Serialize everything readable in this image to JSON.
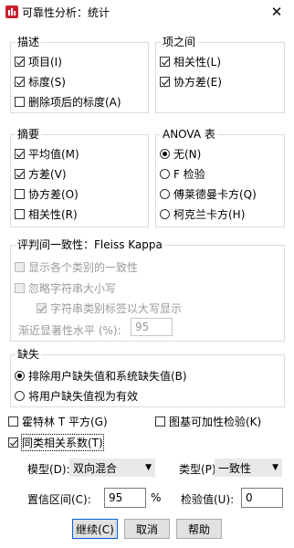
{
  "window": {
    "title": "可靠性分析：统计",
    "close_label": "✕"
  },
  "descriptives": {
    "legend": "描述",
    "items": [
      {
        "label": "项目(I)",
        "checked": true
      },
      {
        "label": "标度(S)",
        "checked": true
      },
      {
        "label": "删除项后的标度(A)",
        "checked": false
      }
    ]
  },
  "inter_item": {
    "legend": "项之间",
    "items": [
      {
        "label": "相关性(L)",
        "checked": true
      },
      {
        "label": "协方差(E)",
        "checked": true
      }
    ]
  },
  "summaries": {
    "legend": "摘要",
    "items": [
      {
        "label": "平均值(M)",
        "checked": true
      },
      {
        "label": "方差(V)",
        "checked": true
      },
      {
        "label": "协方差(O)",
        "checked": false
      },
      {
        "label": "相关性(R)",
        "checked": false
      }
    ]
  },
  "anova": {
    "legend": "ANOVA 表",
    "options": [
      {
        "label": "无(N)",
        "selected": true
      },
      {
        "label": "F 检验",
        "selected": false
      },
      {
        "label": "傅莱德曼卡方(Q)",
        "selected": false
      },
      {
        "label": "柯克兰卡方(H)",
        "selected": false
      }
    ]
  },
  "fleiss": {
    "legend": "评判间一致性：Fleiss Kappa",
    "items": [
      {
        "label": "显示各个类别的一致性",
        "checked": false
      },
      {
        "label": "忽略字符串大小写",
        "checked": false
      },
      {
        "label": "字符串类别标签以大写显示",
        "checked": true
      }
    ],
    "sig_label": "渐近显著性水平 (%):",
    "sig_value": "95"
  },
  "missing": {
    "legend": "缺失",
    "options": [
      {
        "label": "排除用户缺失值和系统缺失值(B)",
        "selected": true
      },
      {
        "label": "将用户缺失值视为有效",
        "selected": false
      }
    ]
  },
  "extra_checks": {
    "hotelling": {
      "label": "霍特林 T 平方(G)",
      "checked": false
    },
    "tukey": {
      "label": "图基可加性检验(K)",
      "checked": false
    },
    "icc": {
      "label": "同类相关系数(T)",
      "checked": true
    }
  },
  "icc_settings": {
    "model_label": "模型(D):",
    "model_value": "双向混合",
    "type_label": "类型(P):",
    "type_value": "一致性",
    "ci_label": "置信区间(C):",
    "ci_value": "95",
    "ci_unit": "%",
    "test_label": "检验值(U):",
    "test_value": "0"
  },
  "buttons": {
    "continue": "继续(C)",
    "cancel": "取消",
    "help": "帮助"
  }
}
